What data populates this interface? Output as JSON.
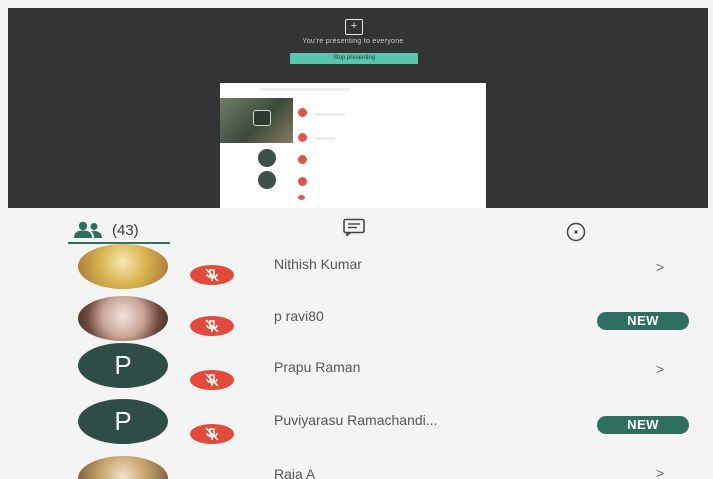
{
  "stage": {
    "presenting_text": "You're presenting to everyone",
    "stop_button_label": "Stop presenting"
  },
  "tabs": {
    "people_count": "(43)",
    "chat_icon": "chat-icon",
    "activities_icon": "activities-icon"
  },
  "participants": [
    {
      "name": "Nithish Kumar",
      "avatar": "photo",
      "trailing": ">"
    },
    {
      "name": "p ravi80",
      "avatar": "photo",
      "trailing": "NEW"
    },
    {
      "name": "Prapu Raman",
      "avatar": "P",
      "trailing": ">"
    },
    {
      "name": "Puviyarasu Ramachandi...",
      "avatar": "P",
      "trailing": "NEW"
    },
    {
      "name": "Raja A",
      "avatar": "photo",
      "trailing": ">"
    }
  ],
  "colors": {
    "stage_bg": "#343434",
    "accent": "#2f6f60",
    "mute_red": "#e24a3c",
    "stop_green": "#58c7a9"
  }
}
